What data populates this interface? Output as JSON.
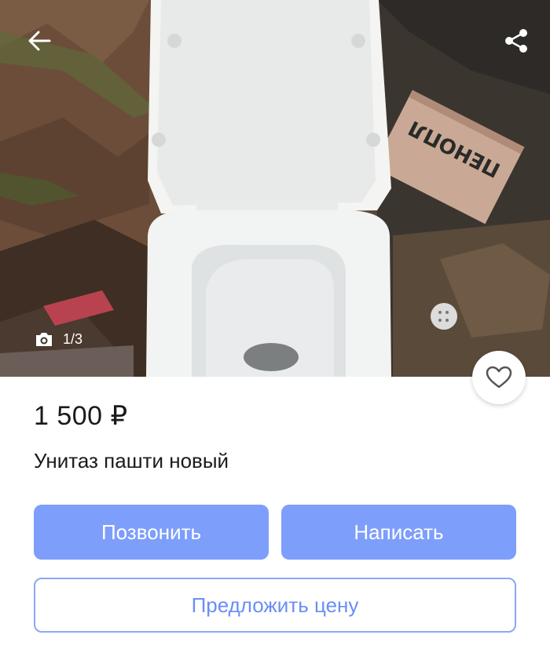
{
  "photo": {
    "counter": "1/3",
    "box_text": "ПЕНОПЛ"
  },
  "icons": {
    "back": "arrow-left-icon",
    "share": "share-icon",
    "camera": "camera-icon",
    "favorite": "heart-outline-icon"
  },
  "listing": {
    "price": "1 500 ₽",
    "title": "Унитаз пашти новый"
  },
  "actions": {
    "call_label": "Позвонить",
    "write_label": "Написать",
    "offer_label": "Предложить цену"
  },
  "colors": {
    "primary_button": "#7d9efb",
    "outline_button_text": "#6a8ef5"
  }
}
